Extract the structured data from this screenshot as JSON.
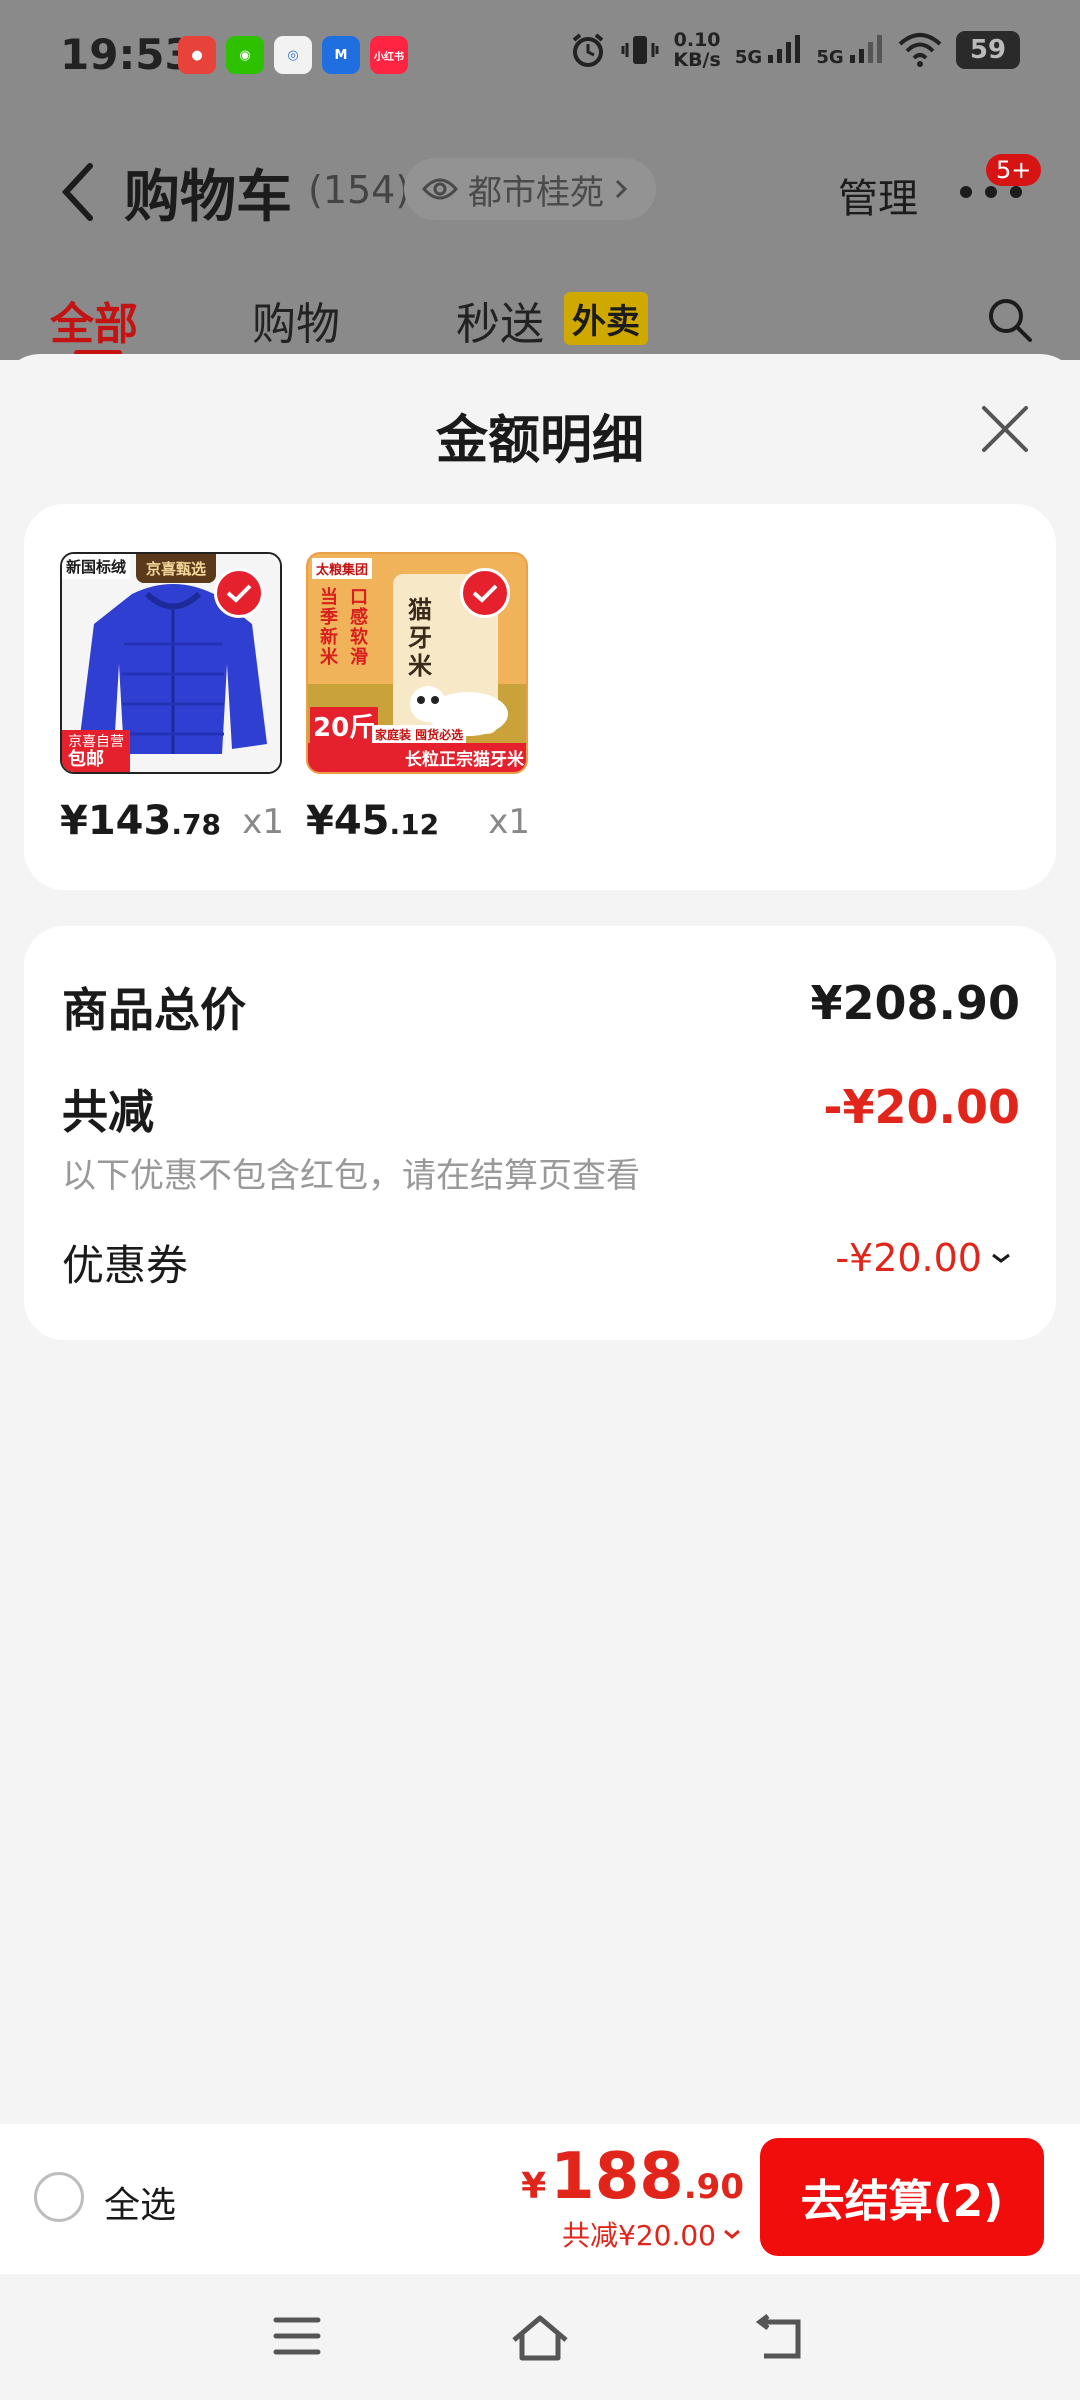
{
  "status_bar": {
    "time": "19:53",
    "net_speed_value": "0.10",
    "net_speed_unit": "KB/s",
    "signal1_label": "5G",
    "signal2_label": "5G",
    "battery": "59",
    "apps": [
      "pinduoduo-app-icon",
      "wechat-app-icon",
      "browser-app-icon",
      "map-app-icon",
      "xiaohongshu-app-icon"
    ],
    "xiaohongshu_label": "小红书"
  },
  "header": {
    "title": "购物车",
    "count": "(154)",
    "location": "都市桂苑",
    "manage": "管理",
    "badge": "5+"
  },
  "tabs": {
    "all": "全部",
    "shopping": "购物",
    "fast": "秒送",
    "fast_tag": "外卖"
  },
  "sheet": {
    "title": "金额明细",
    "items": [
      {
        "price_int": "¥143",
        "price_dec": ".78",
        "qty": "x1",
        "img_tag_top": "京喜甄选",
        "img_label_left": "新国标绒",
        "img_tag_bottom": "京喜自营",
        "img_tag_bottom2": "包邮"
      },
      {
        "price_int": "¥45",
        "price_dec": ".12",
        "qty": "x1",
        "img_brand": "太粮集团",
        "img_text_1": "当季新米",
        "img_text_2": "口感软滑",
        "img_text_3": "猫牙米",
        "img_banner": "长粒正宗猫牙米",
        "img_weight": "20斤",
        "img_sub": "家庭装 囤货必选"
      }
    ],
    "summary": {
      "total_label": "商品总价",
      "total_value": "¥208.90",
      "reduce_label": "共减",
      "reduce_value": "-¥20.00",
      "note": "以下优惠不包含红包，请在结算页查看",
      "coupon_label": "优惠券",
      "coupon_value": "-¥20.00"
    }
  },
  "bottom_bar": {
    "select_all": "全选",
    "pay_yen": "¥",
    "pay_int": "188",
    "pay_dec": ".90",
    "pay_reduce": "共减¥20.00",
    "checkout": "去结算(2)"
  },
  "colors": {
    "accent_red": "#e1251b",
    "button_red": "#f20d0d",
    "tag_yellow": "#cfa800"
  }
}
